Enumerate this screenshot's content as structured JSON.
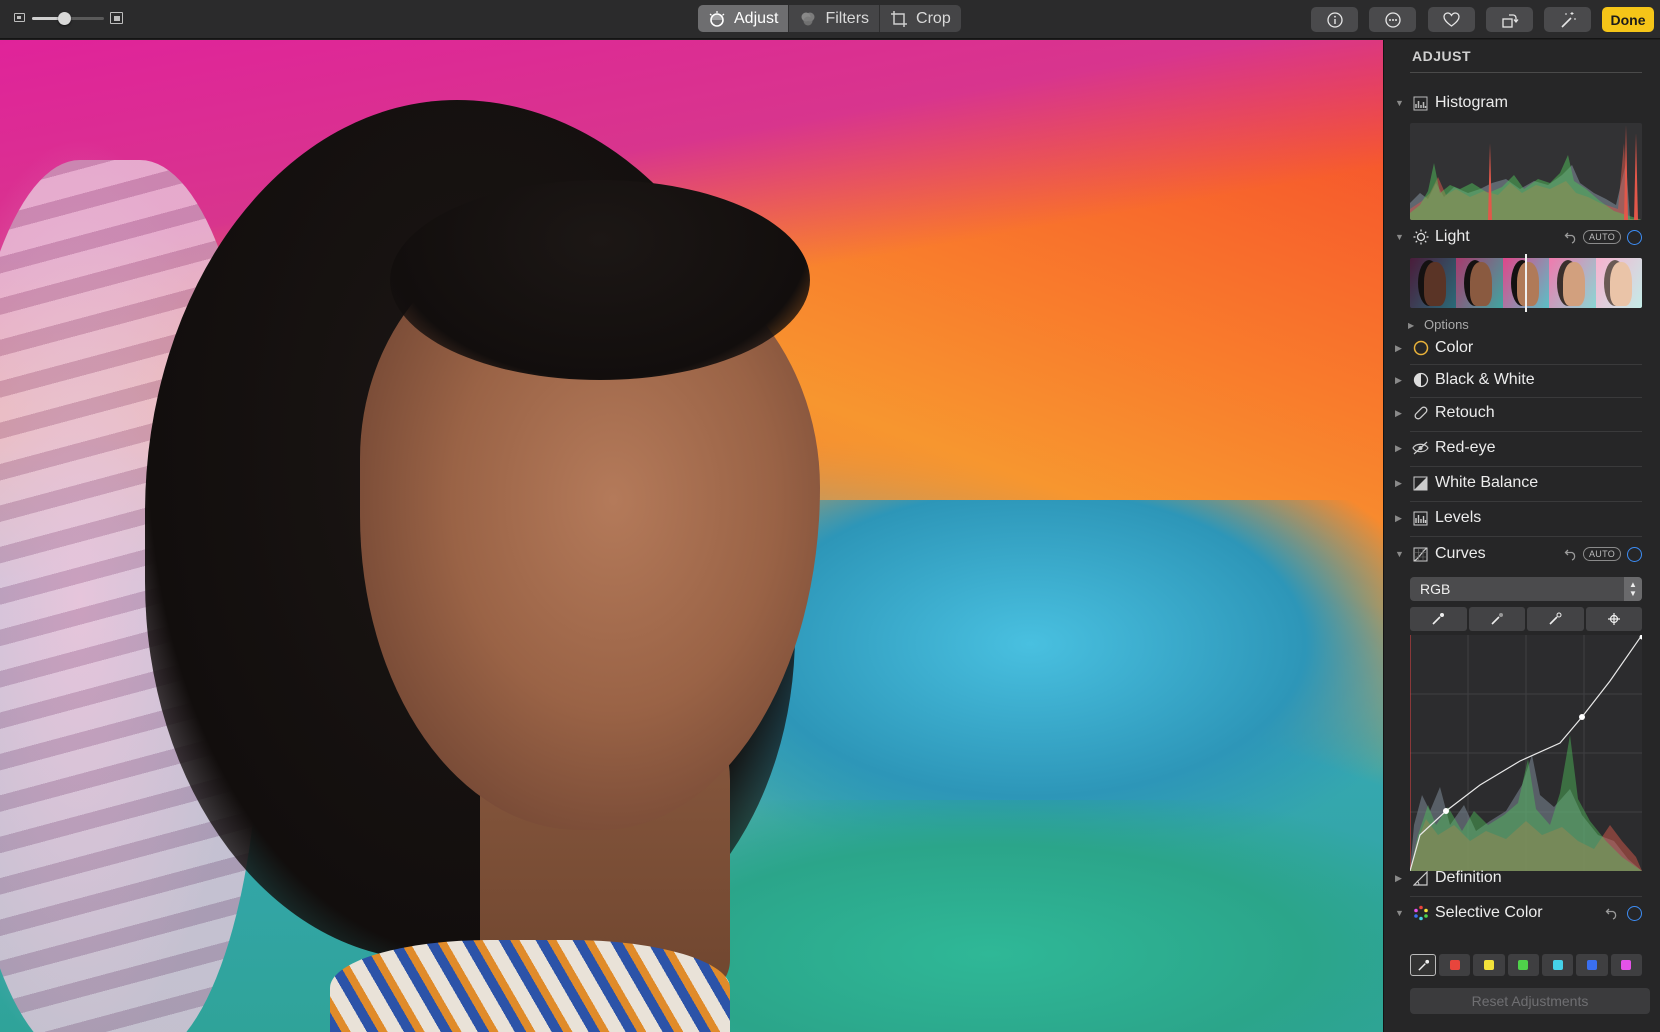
{
  "toolbar": {
    "zoom_level": 0.45,
    "tabs": [
      {
        "label": "Adjust",
        "icon": "adjust-dial-icon",
        "active": true
      },
      {
        "label": "Filters",
        "icon": "filters-circles-icon",
        "active": false
      },
      {
        "label": "Crop",
        "icon": "crop-icon",
        "active": false
      }
    ],
    "buttons": [
      "info-icon",
      "more-icon",
      "heart-icon",
      "rotate-icon",
      "magic-wand-icon"
    ],
    "done_label": "Done",
    "done_color": "#f5c518"
  },
  "sidebar": {
    "title": "ADJUST",
    "options_label": "Options",
    "auto_label": "AUTO",
    "sections": {
      "histogram": "Histogram",
      "light": "Light",
      "color": "Color",
      "bw": "Black & White",
      "retouch": "Retouch",
      "redeye": "Red-eye",
      "white_balance": "White Balance",
      "levels": "Levels",
      "curves": "Curves",
      "definition": "Definition",
      "selective_color": "Selective Color"
    },
    "curves_channel": "RGB",
    "selective_colors": [
      "#e8453c",
      "#f2e23a",
      "#4fd24a",
      "#45d1e8",
      "#3a6ff0",
      "#e453e8"
    ],
    "reset_label": "Reset Adjustments",
    "accent": "#3d8df5"
  }
}
